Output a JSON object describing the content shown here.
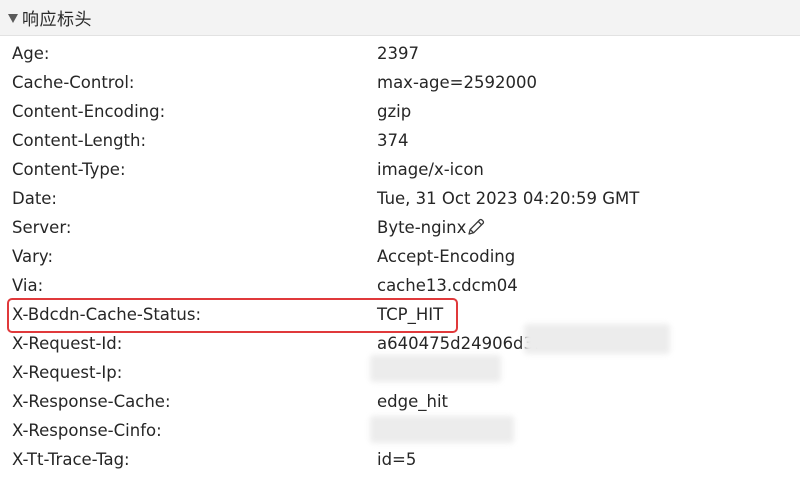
{
  "section": {
    "title": "响应标头"
  },
  "headers": [
    {
      "name": "Age:",
      "value": "2397"
    },
    {
      "name": "Cache-Control:",
      "value": "max-age=2592000"
    },
    {
      "name": "Content-Encoding:",
      "value": "gzip"
    },
    {
      "name": "Content-Length:",
      "value": "374"
    },
    {
      "name": "Content-Type:",
      "value": "image/x-icon"
    },
    {
      "name": "Date:",
      "value": "Tue, 31 Oct 2023 04:20:59 GMT"
    },
    {
      "name": "Server:",
      "value": "Byte-nginx"
    },
    {
      "name": "Vary:",
      "value": "Accept-Encoding"
    },
    {
      "name": "Via:",
      "value": "cache13.cdcm04"
    },
    {
      "name": "X-Bdcdn-Cache-Status:",
      "value": "TCP_HIT"
    },
    {
      "name": "X-Request-Id:",
      "value": "a640475d24906d3f"
    },
    {
      "name": "X-Request-Ip:",
      "value": ""
    },
    {
      "name": "X-Response-Cache:",
      "value": "edge_hit"
    },
    {
      "name": "X-Response-Cinfo:",
      "value": ""
    },
    {
      "name": "X-Tt-Trace-Tag:",
      "value": "id=5"
    }
  ],
  "icons": {
    "section_toggle": "triangle-down-icon",
    "server_edit": "pencil-icon"
  },
  "colors": {
    "highlight_border": "#e0393b",
    "header_bg": "#f3f3f3"
  }
}
